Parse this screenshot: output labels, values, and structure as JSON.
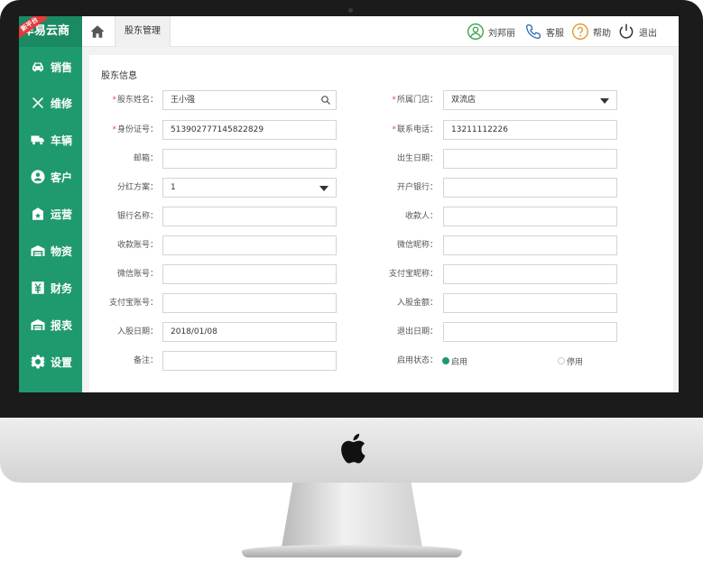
{
  "brand": {
    "name": "车易云商",
    "ribbon": "新平台"
  },
  "sidebar": {
    "items": [
      {
        "label": "销售",
        "icon": "car-icon"
      },
      {
        "label": "维修",
        "icon": "tools-icon"
      },
      {
        "label": "车辆",
        "icon": "truck-icon"
      },
      {
        "label": "客户",
        "icon": "customer-icon"
      },
      {
        "label": "运营",
        "icon": "operation-icon"
      },
      {
        "label": "物资",
        "icon": "warehouse-icon"
      },
      {
        "label": "财务",
        "icon": "finance-icon"
      },
      {
        "label": "报表",
        "icon": "report-icon"
      },
      {
        "label": "设置",
        "icon": "gear-icon"
      }
    ]
  },
  "topbar": {
    "tab": "股东管理",
    "user": "刘邦丽",
    "service": "客服",
    "help": "帮助",
    "logout": "退出"
  },
  "form": {
    "title": "股东信息",
    "left": [
      {
        "label": "股东姓名：",
        "required": true,
        "value": "王小强",
        "kind": "search"
      },
      {
        "label": "身份证号：",
        "required": true,
        "value": "513902777145822829",
        "kind": "text"
      },
      {
        "label": "邮箱：",
        "required": false,
        "value": "",
        "kind": "text"
      },
      {
        "label": "分红方案：",
        "required": false,
        "value": "1",
        "kind": "select"
      },
      {
        "label": "银行名称：",
        "required": false,
        "value": "",
        "kind": "text"
      },
      {
        "label": "收款账号：",
        "required": false,
        "value": "",
        "kind": "text"
      },
      {
        "label": "微信账号：",
        "required": false,
        "value": "",
        "kind": "text"
      },
      {
        "label": "支付宝账号：",
        "required": false,
        "value": "",
        "kind": "text"
      },
      {
        "label": "入股日期：",
        "required": false,
        "value": "2018/01/08",
        "kind": "text"
      },
      {
        "label": "备注：",
        "required": false,
        "value": "",
        "kind": "text"
      }
    ],
    "right": [
      {
        "label": "所属门店：",
        "required": true,
        "value": "双流店",
        "kind": "select"
      },
      {
        "label": "联系电话：",
        "required": true,
        "value": "13211112226",
        "kind": "text"
      },
      {
        "label": "出生日期：",
        "required": false,
        "value": "",
        "kind": "text"
      },
      {
        "label": "开户银行：",
        "required": false,
        "value": "",
        "kind": "text"
      },
      {
        "label": "收款人：",
        "required": false,
        "value": "",
        "kind": "text"
      },
      {
        "label": "微信昵称：",
        "required": false,
        "value": "",
        "kind": "text"
      },
      {
        "label": "支付宝昵称：",
        "required": false,
        "value": "",
        "kind": "text"
      },
      {
        "label": "入股金额：",
        "required": false,
        "value": "",
        "kind": "text"
      },
      {
        "label": "退出日期：",
        "required": false,
        "value": "",
        "kind": "text"
      }
    ],
    "status": {
      "label": "启用状态：",
      "options": [
        "启用",
        "停用"
      ],
      "selected": 0
    }
  },
  "colors": {
    "accent": "#1f9a6e",
    "required": "#e05050",
    "user_icon": "#3aa04a",
    "service_icon": "#2f6db5",
    "help_icon": "#e0962a"
  }
}
